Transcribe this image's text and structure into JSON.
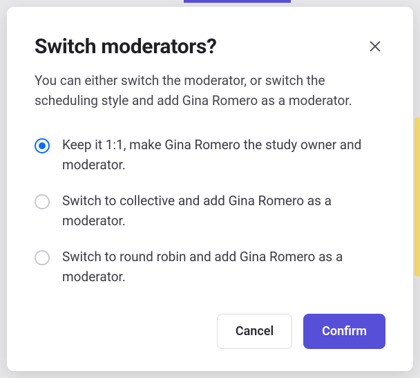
{
  "modal": {
    "title": "Switch moderators?",
    "description": "You can either switch the moderator, or switch the scheduling style and add Gina Romero as a moderator.",
    "options": [
      {
        "label": "Keep it 1:1, make Gina Romero the study owner and moderator.",
        "selected": true
      },
      {
        "label": "Switch to collective and add Gina Romero as a moderator.",
        "selected": false
      },
      {
        "label": "Switch to round robin and add Gina Romero as a moderator.",
        "selected": false
      }
    ],
    "cancel_label": "Cancel",
    "confirm_label": "Confirm"
  }
}
